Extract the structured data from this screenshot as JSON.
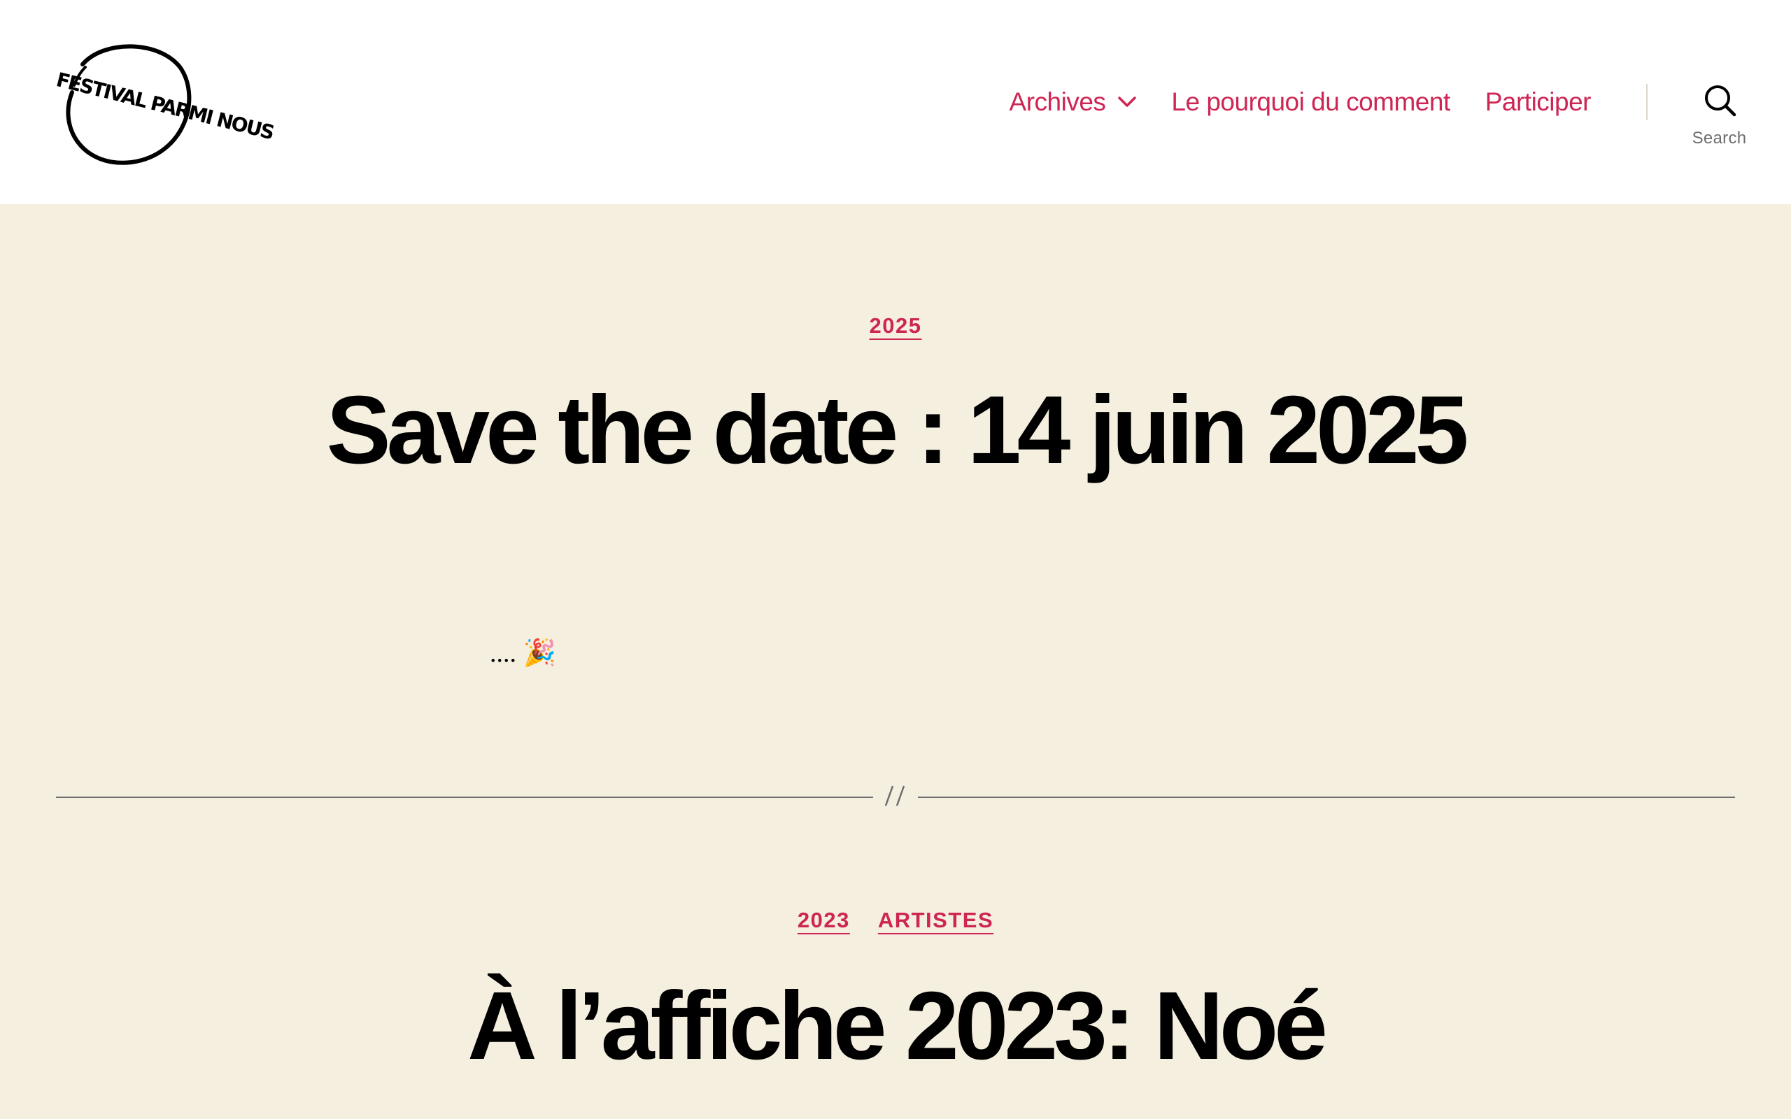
{
  "header": {
    "logo_text": "FESTIVAL PARMI NOUS",
    "nav": {
      "items": [
        {
          "label": "Archives",
          "has_dropdown": true
        },
        {
          "label": "Le pourquoi du comment"
        },
        {
          "label": "Participer"
        }
      ]
    },
    "search_label": "Search",
    "search_icon": "search-icon"
  },
  "posts": [
    {
      "categories": [
        "2025"
      ],
      "title": "Save the date : 14 juin 2025",
      "excerpt": ".... 🎉"
    },
    {
      "categories": [
        "2023",
        "ARTISTES"
      ],
      "title": "À l’affiche 2023: Noé"
    }
  ],
  "colors": {
    "accent": "#cd2653",
    "background": "#f5efe0",
    "header_bg": "#ffffff",
    "text": "#000000",
    "muted": "#6d6d6d"
  }
}
